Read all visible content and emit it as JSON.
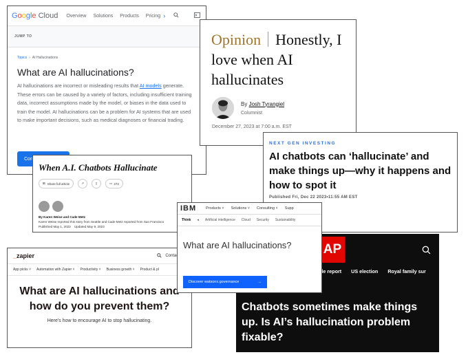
{
  "google_cloud": {
    "logo": {
      "g1": "G",
      "g2": "o",
      "g3": "o",
      "g4": "g",
      "g5": "l",
      "g6": "e",
      "cloud": " Cloud"
    },
    "nav": [
      "Overview",
      "Solutions",
      "Products",
      "Pricing"
    ],
    "jump_to": "JUMP TO",
    "breadcrumb": {
      "root": "Topics",
      "current": "AI Hallucinations"
    },
    "title": "What are AI hallucinations?",
    "body_before_link": "AI hallucinations are incorrect or misleading results that ",
    "link": "AI models",
    "body_after_link": " generate. These errors can be caused by a variety of factors, including insufficient training data, incorrect assumptions made by the model, or biases in the data used to train the model. AI hallucinations can be a problem for AI systems that are used to make important decisions, such as medical diagnoses or financial trading.",
    "cta": "Con"
  },
  "wapo": {
    "section": "Opinion",
    "headline": "Honestly, I love when AI hallucinates",
    "by_prefix": "By ",
    "author": "Josh Tyrangiel",
    "role": "Columnist",
    "date": "December 27, 2023 at 7:00 a.m. EST"
  },
  "fortune": {
    "kicker": "NEXT GEN INVESTING",
    "headline": "AI chatbots can ‘hallucinate’ and make things up—why it happens and how to spot it",
    "published": "Published Fri, Dec 22 2023•11:55 AM EST"
  },
  "nyt": {
    "headline": "When A.I. Chatbots Hallucinate",
    "share": "Share full article",
    "comments": "272",
    "byline": "By Karen Weise and Cade Metz",
    "reported": "Karen Weise reported this story from Seattle and Cade Metz reported from San Francisco",
    "dates": "Published May 1, 2023    Updated May 9, 2023"
  },
  "ibm": {
    "logo": "IBM",
    "nav": [
      "Products",
      "Solutions",
      "Consulting",
      "Supp"
    ],
    "subnav": [
      "Think",
      "Artificial intelligence",
      "Cloud",
      "Security",
      "Sustainability"
    ],
    "question": "What are AI hallucinations?",
    "button": "Discover watsonx.governance"
  },
  "ap": {
    "logo": "AP",
    "nav": [
      "de report",
      "US election",
      "Royal family sur"
    ],
    "headline": "Chatbots sometimes make things up. Is AI’s hallucination problem fixable?"
  },
  "zapier": {
    "logo_us": "_",
    "logo": "zapier",
    "contact": "Contact Sa",
    "nav": [
      "App picks",
      "Automation with Zapier",
      "Productivity",
      "Business growth",
      "Product & pl"
    ],
    "headline": "What are AI hallucinations and how do you prevent them?",
    "subhead": "Here's how to encourage AI to stop hallucinating."
  }
}
